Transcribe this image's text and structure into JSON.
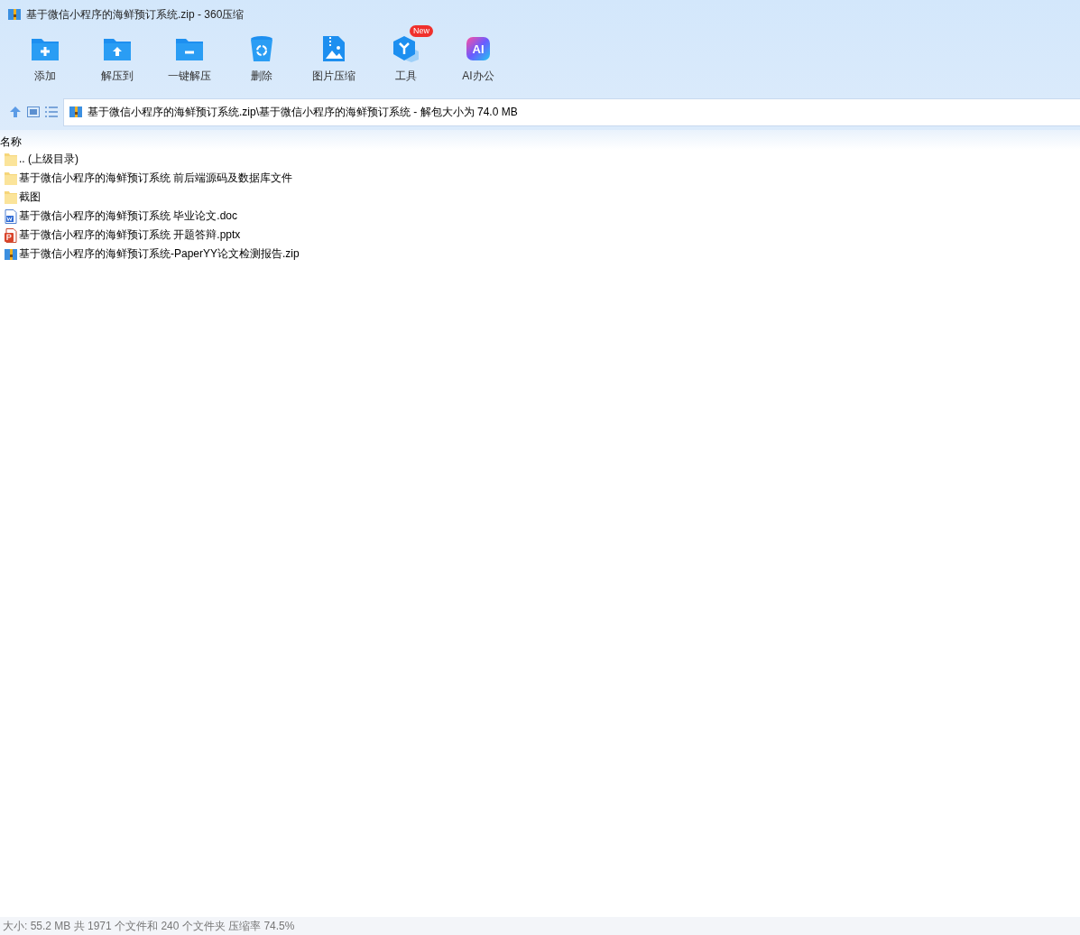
{
  "window": {
    "title": "基于微信小程序的海鲜预订系统.zip - 360压缩"
  },
  "toolbar": [
    {
      "kind": "add",
      "label": "添加"
    },
    {
      "kind": "extract-to",
      "label": "解压到"
    },
    {
      "kind": "extract",
      "label": "一键解压"
    },
    {
      "kind": "delete",
      "label": "删除"
    },
    {
      "kind": "image",
      "label": "图片压缩"
    },
    {
      "kind": "tools",
      "label": "工具",
      "badge": "New"
    },
    {
      "kind": "ai",
      "label": "AI办公",
      "icon_text": "AI"
    }
  ],
  "address": {
    "value": "基于微信小程序的海鲜预订系统.zip\\基于微信小程序的海鲜预订系统 - 解包大小为 74.0 MB"
  },
  "table": {
    "columns": [
      "名称"
    ],
    "rows": [
      {
        "kind": "folder",
        "name": ".. (上级目录)"
      },
      {
        "kind": "folder",
        "name": "基于微信小程序的海鲜预订系统 前后端源码及数据库文件"
      },
      {
        "kind": "folder",
        "name": "截图"
      },
      {
        "kind": "doc",
        "name": "基于微信小程序的海鲜预订系统 毕业论文.doc"
      },
      {
        "kind": "pptx",
        "name": "基于微信小程序的海鲜预订系统 开题答辩.pptx"
      },
      {
        "kind": "zip",
        "name": "基于微信小程序的海鲜预订系统-PaperYY论文检测报告.zip"
      }
    ]
  },
  "status_bar": "大小: 55.2 MB 共 1971 个文件和 240 个文件夹 压缩率 74.5%"
}
